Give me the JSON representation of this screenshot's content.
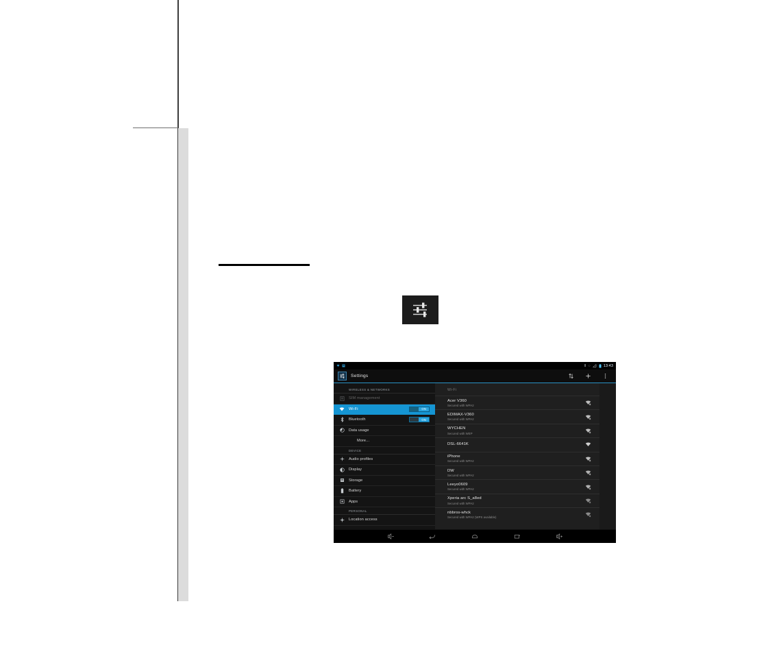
{
  "page": {
    "decorations": [
      "vertical-rule",
      "horizontal-rule",
      "gray-band",
      "black-rule"
    ]
  },
  "standalone_icon": {
    "name": "settings-sliders-icon"
  },
  "tablet": {
    "statusbar": {
      "left_icons": [
        "wifi-icon",
        "sim-card-icon"
      ],
      "right_icons": [
        "vibrate-icon",
        "sync-icon",
        "signal-icon",
        "battery-icon"
      ],
      "clock": "13:43"
    },
    "actionbar": {
      "app_icon": "settings-app-icon",
      "title": "Settings",
      "icons": [
        {
          "name": "scan-icon",
          "glyph": "⇅"
        },
        {
          "name": "add-network-icon",
          "glyph": "+"
        },
        {
          "name": "overflow-menu-icon",
          "glyph": "⋮"
        }
      ]
    },
    "sidebar": {
      "sections": [
        {
          "header": "WIRELESS & NETWORKS",
          "items": [
            {
              "label": "SIM management",
              "icon": "sim-card-icon",
              "state": "disabled",
              "toggle": null
            },
            {
              "label": "Wi-Fi",
              "icon": "wifi-icon",
              "state": "selected",
              "toggle": "ON"
            },
            {
              "label": "Bluetooth",
              "icon": "bluetooth-icon",
              "state": "normal",
              "toggle": "ON"
            },
            {
              "label": "Data usage",
              "icon": "data-usage-icon",
              "state": "normal",
              "toggle": null
            },
            {
              "label": "More...",
              "icon": null,
              "state": "normal",
              "toggle": null
            }
          ]
        },
        {
          "header": "DEVICE",
          "items": [
            {
              "label": "Audio profiles",
              "icon": "audio-profiles-icon",
              "state": "normal",
              "toggle": null
            },
            {
              "label": "Display",
              "icon": "display-icon",
              "state": "normal",
              "toggle": null
            },
            {
              "label": "Storage",
              "icon": "storage-icon",
              "state": "normal",
              "toggle": null
            },
            {
              "label": "Battery",
              "icon": "battery-icon",
              "state": "normal",
              "toggle": null
            },
            {
              "label": "Apps",
              "icon": "apps-icon",
              "state": "normal",
              "toggle": null
            }
          ]
        },
        {
          "header": "PERSONAL",
          "items": [
            {
              "label": "Location access",
              "icon": "location-icon",
              "state": "normal",
              "toggle": null
            }
          ]
        }
      ]
    },
    "content": {
      "title": "Wi-Fi",
      "networks": [
        {
          "ssid": "Acer V360",
          "security": "Secured with WPA2",
          "signal": "wifi-signal-secured-icon"
        },
        {
          "ssid": "EDIMAX-V360",
          "security": "Secured with WPA2",
          "signal": "wifi-signal-secured-icon"
        },
        {
          "ssid": "WYCHEN",
          "security": "Secured with WEP",
          "signal": "wifi-signal-secured-icon"
        },
        {
          "ssid": "DSL-6641K",
          "security": "",
          "signal": "wifi-signal-open-icon"
        },
        {
          "ssid": "iPhone",
          "security": "Secured with WPA2",
          "signal": "wifi-signal-secured-icon"
        },
        {
          "ssid": "DW",
          "security": "Secured with WPA2",
          "signal": "wifi-signal-secured-icon"
        },
        {
          "ssid": "Leeyo0609",
          "security": "Secured with WPA2",
          "signal": "wifi-signal-secured-icon"
        },
        {
          "ssid": "Xperia arc S_a8ed",
          "security": "Secured with WPA2",
          "signal": "wifi-signal-secured-icon"
        },
        {
          "ssid": "nbbros-whck",
          "security": "Secured with WPA2 (WPS available)",
          "signal": "wifi-signal-secured-icon"
        }
      ]
    },
    "navbar": {
      "buttons": [
        {
          "name": "volume-down-button",
          "glyph": "◁−"
        },
        {
          "name": "back-button",
          "glyph": "↩"
        },
        {
          "name": "home-button",
          "glyph": "⌂"
        },
        {
          "name": "recents-button",
          "glyph": "▭"
        },
        {
          "name": "volume-up-button",
          "glyph": "◁+"
        }
      ]
    }
  },
  "colors": {
    "accent": "#1595d3",
    "toggle_on": "#29a3dd",
    "actionbar_underline": "#2a93c7"
  }
}
